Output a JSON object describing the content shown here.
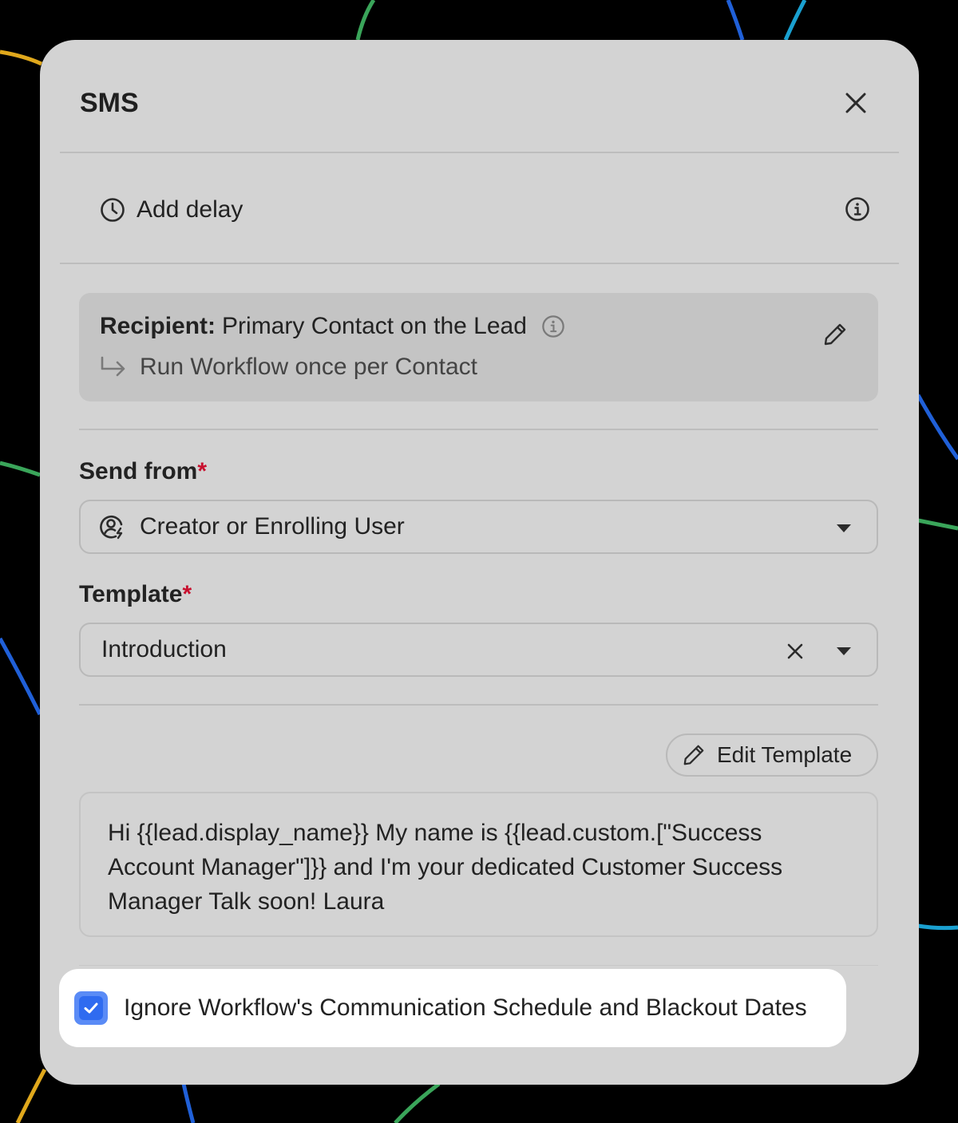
{
  "dialog": {
    "title": "SMS"
  },
  "delay": {
    "label": "Add delay"
  },
  "recipient": {
    "key": "Recipient:",
    "value": "Primary Contact on the Lead",
    "run_mode": "Run Workflow once per Contact"
  },
  "send_from": {
    "label": "Send from",
    "required_mark": "*",
    "value": "Creator or Enrolling User"
  },
  "template": {
    "label": "Template",
    "required_mark": "*",
    "value": "Introduction",
    "edit_button": "Edit Template",
    "preview": "Hi {{lead.display_name}} My name is {{lead.custom.[\"Success Account Manager\"]}} and I'm your dedicated Customer Success Manager Talk soon! Laura"
  },
  "ignore_schedule": {
    "label": "Ignore Workflow's Communication Schedule and Blackout Dates",
    "checked": true
  },
  "colors": {
    "panel": "#d3d3d3",
    "card": "#c4c4c4",
    "required": "#c8102e",
    "checkbox": "#2f6bf0",
    "background": "#000000"
  },
  "icons": {
    "close": "close-icon",
    "delay": "clock-icon",
    "info": "info-icon",
    "edit": "pencil-icon",
    "run_mode": "return-arrow-icon",
    "user": "user-sync-icon",
    "caret": "caret-down-icon",
    "clear": "clear-icon",
    "check": "check-icon"
  }
}
